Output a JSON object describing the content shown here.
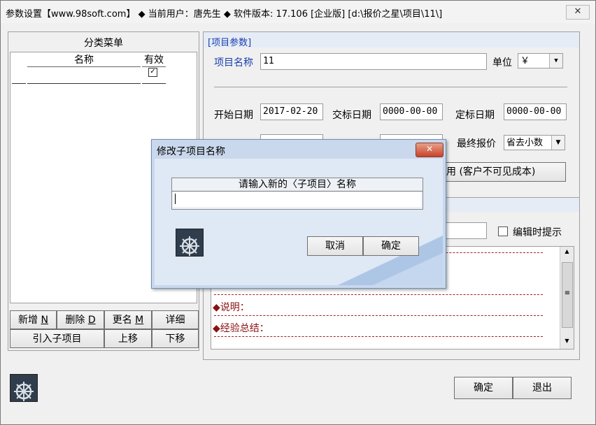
{
  "window": {
    "title": "参数设置【www.98soft.com】 ◆ 当前用户：唐先生 ◆ 软件版本: 17.106 [企业版] [d:\\报价之星\\项目\\11\\]",
    "close_glyph": "✕"
  },
  "left_panel": {
    "title": "分类菜单",
    "col_name": "名称",
    "col_valid": "有效",
    "buttons": {
      "add": "新增",
      "add_key": "N",
      "delete": "删除",
      "delete_key": "D",
      "rename": "更名",
      "rename_key": "M",
      "detail": "详细",
      "import_sub": "引入子项目",
      "move_up": "上移",
      "move_down": "下移"
    }
  },
  "right_panel": {
    "section_title": "[项目参数]",
    "project_name_label": "项目名称",
    "project_name_value": "11",
    "unit_label": "单位",
    "unit_value": "￥",
    "start_date_label": "开始日期",
    "start_date_value": "2017-02-20",
    "delivery_date_label": "交标日期",
    "delivery_date_value": "0000-00-00",
    "award_date_label": "定标日期",
    "award_date_value": "0000-00-00",
    "final_quote_label": "最终报价",
    "final_quote_value": "省去小数",
    "customer_btn_label": "用 (客户不可见成本)",
    "edit_prompt_label": "编辑时提示",
    "note_label": "◆说明：",
    "experience_label": "◆经验总结："
  },
  "footer": {
    "ok": "确定",
    "exit": "退出"
  },
  "dialog": {
    "title": "修改子项目名称",
    "prompt": "请输入新的〈子项目〉名称",
    "input_value": "",
    "cancel": "取消",
    "ok": "确定",
    "close_glyph": "✕"
  }
}
